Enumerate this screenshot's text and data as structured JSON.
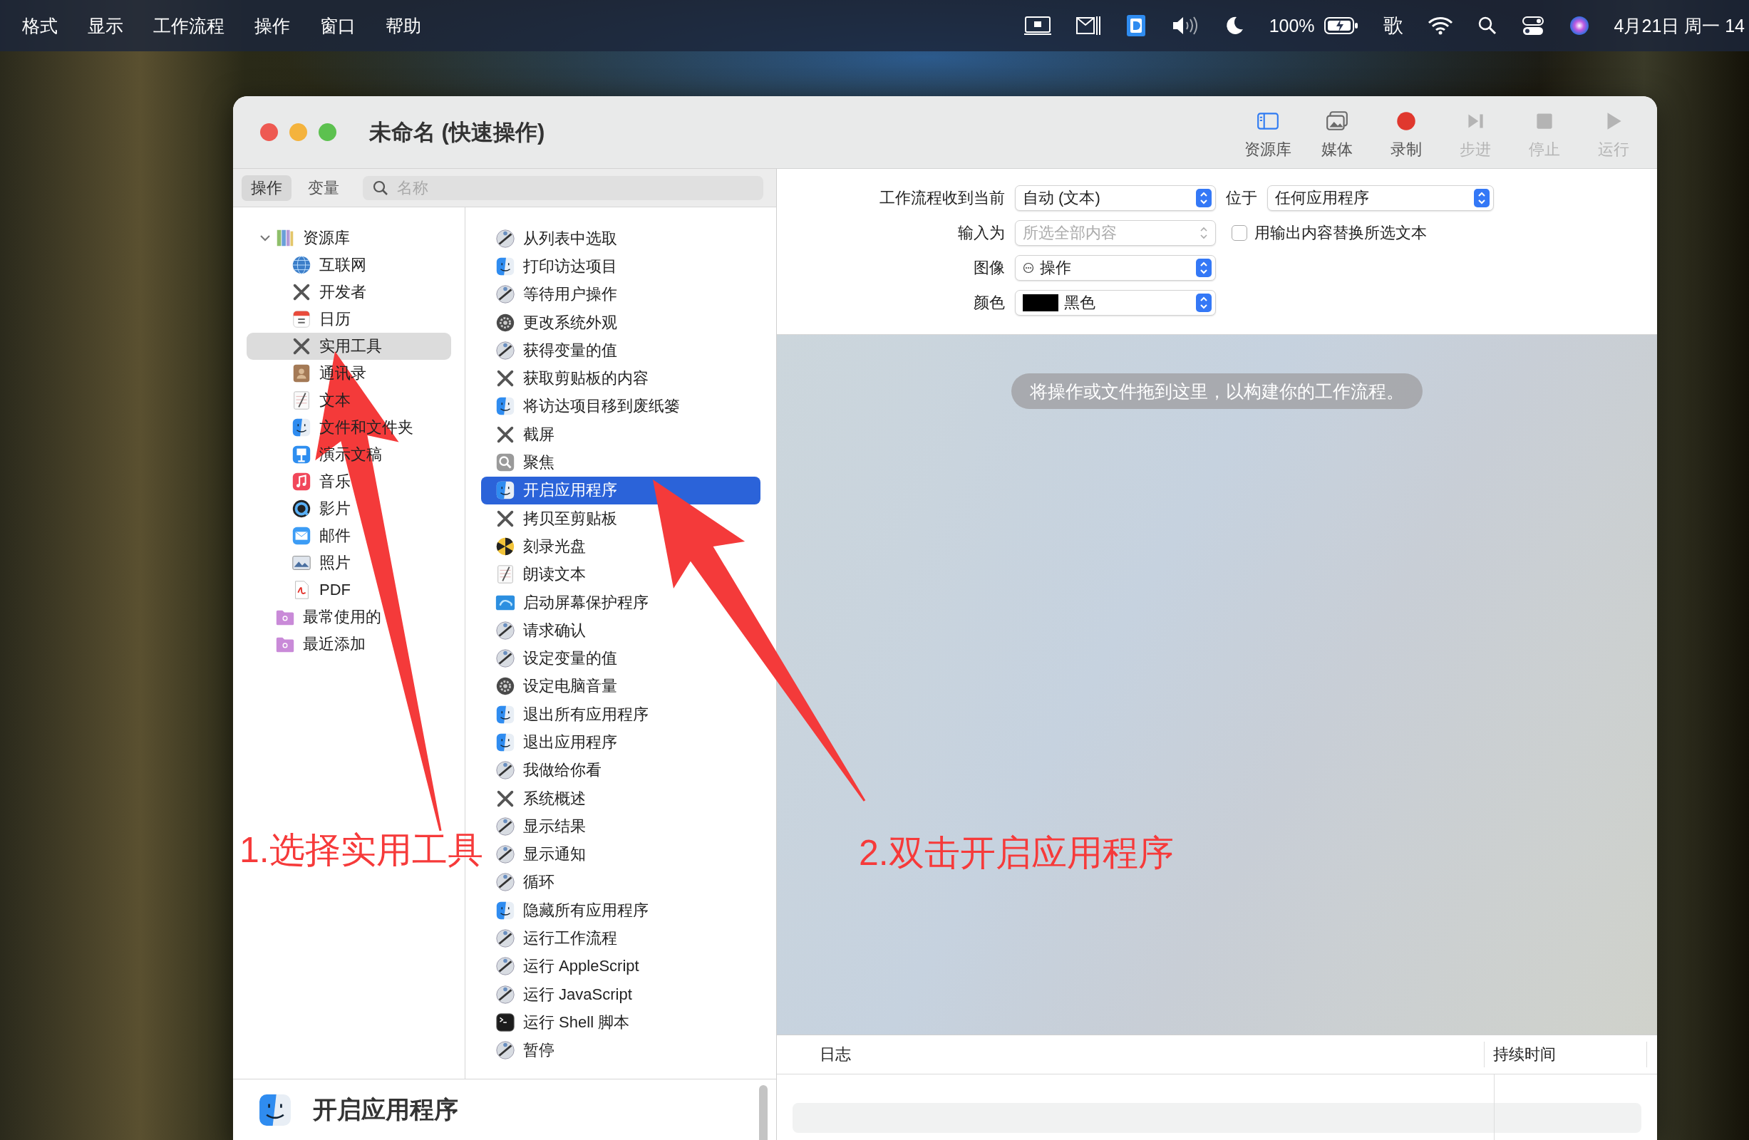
{
  "menu_bar": {
    "menus": [
      "格式",
      "显示",
      "工作流程",
      "操作",
      "窗口",
      "帮助"
    ],
    "battery": "100%",
    "input_method": "歌",
    "clock": "4月21日 周一 14"
  },
  "window": {
    "title": "未命名 (快速操作)",
    "toolbar": [
      {
        "label": "资源库",
        "kind": "library",
        "on": true,
        "disabled": false
      },
      {
        "label": "媒体",
        "kind": "media",
        "on": false,
        "disabled": false
      },
      {
        "label": "录制",
        "kind": "record",
        "disabled": false
      },
      {
        "label": "步进",
        "kind": "step",
        "disabled": true
      },
      {
        "label": "停止",
        "kind": "stop",
        "disabled": true
      },
      {
        "label": "运行",
        "kind": "run",
        "disabled": true
      }
    ]
  },
  "library_tabs": [
    {
      "label": "操作",
      "selected": true
    },
    {
      "label": "变量",
      "selected": false
    }
  ],
  "search": {
    "placeholder": "名称"
  },
  "library": [
    {
      "label": "资源库",
      "kind": "library",
      "expanded": true,
      "selected": false,
      "children": [
        {
          "label": "互联网",
          "kind": "globe",
          "selected": false
        },
        {
          "label": "开发者",
          "kind": "tools",
          "selected": false
        },
        {
          "label": "日历",
          "kind": "calendar",
          "selected": false
        },
        {
          "label": "实用工具",
          "kind": "tools",
          "selected": true
        },
        {
          "label": "通讯录",
          "kind": "contacts",
          "selected": false
        },
        {
          "label": "文本",
          "kind": "textedit",
          "selected": false
        },
        {
          "label": "文件和文件夹",
          "kind": "finder",
          "selected": false
        },
        {
          "label": "演示文稿",
          "kind": "keynote",
          "selected": false
        },
        {
          "label": "音乐",
          "kind": "music",
          "selected": false
        },
        {
          "label": "影片",
          "kind": "quicktime",
          "selected": false
        },
        {
          "label": "邮件",
          "kind": "mail",
          "selected": false
        },
        {
          "label": "照片",
          "kind": "photos",
          "selected": false
        },
        {
          "label": "PDF",
          "kind": "pdf",
          "selected": false
        }
      ]
    },
    {
      "label": "最常使用的",
      "kind": "smart-folder",
      "selected": false
    },
    {
      "label": "最近添加",
      "kind": "smart-folder",
      "selected": false
    }
  ],
  "actions": [
    {
      "label": "从列表中选取",
      "kind": "automator",
      "selected": false
    },
    {
      "label": "打印访达项目",
      "kind": "finder",
      "selected": false
    },
    {
      "label": "等待用户操作",
      "kind": "automator",
      "selected": false
    },
    {
      "label": "更改系统外观",
      "kind": "gear",
      "selected": false
    },
    {
      "label": "获得变量的值",
      "kind": "automator",
      "selected": false
    },
    {
      "label": "获取剪贴板的内容",
      "kind": "tools",
      "selected": false
    },
    {
      "label": "将访达项目移到废纸篓",
      "kind": "finder",
      "selected": false
    },
    {
      "label": "截屏",
      "kind": "tools",
      "selected": false
    },
    {
      "label": "聚焦",
      "kind": "spotlight",
      "selected": false
    },
    {
      "label": "开启应用程序",
      "kind": "finder",
      "selected": true
    },
    {
      "label": "拷贝至剪贴板",
      "kind": "tools",
      "selected": false
    },
    {
      "label": "刻录光盘",
      "kind": "disc",
      "selected": false
    },
    {
      "label": "朗读文本",
      "kind": "textedit",
      "selected": false
    },
    {
      "label": "启动屏幕保护程序",
      "kind": "screensaver",
      "selected": false
    },
    {
      "label": "请求确认",
      "kind": "automator",
      "selected": false
    },
    {
      "label": "设定变量的值",
      "kind": "automator",
      "selected": false
    },
    {
      "label": "设定电脑音量",
      "kind": "gear",
      "selected": false
    },
    {
      "label": "退出所有应用程序",
      "kind": "finder",
      "selected": false
    },
    {
      "label": "退出应用程序",
      "kind": "finder",
      "selected": false
    },
    {
      "label": "我做给你看",
      "kind": "automator",
      "selected": false
    },
    {
      "label": "系统概述",
      "kind": "tools",
      "selected": false
    },
    {
      "label": "显示结果",
      "kind": "automator",
      "selected": false
    },
    {
      "label": "显示通知",
      "kind": "automator",
      "selected": false
    },
    {
      "label": "循环",
      "kind": "automator",
      "selected": false
    },
    {
      "label": "隐藏所有应用程序",
      "kind": "finder",
      "selected": false
    },
    {
      "label": "运行工作流程",
      "kind": "automator",
      "selected": false
    },
    {
      "label": "运行 AppleScript",
      "kind": "automator",
      "selected": false
    },
    {
      "label": "运行 JavaScript",
      "kind": "automator",
      "selected": false
    },
    {
      "label": "运行 Shell 脚本",
      "kind": "terminal",
      "selected": false
    },
    {
      "label": "暂停",
      "kind": "automator",
      "selected": false
    }
  ],
  "description": {
    "title": "开启应用程序",
    "kind": "finder"
  },
  "workflow_settings": {
    "receives_label": "工作流程收到当前",
    "receives": {
      "value": "自动 (文本)",
      "disabled": false
    },
    "in_label": "位于",
    "in": {
      "value": "任何应用程序",
      "disabled": false
    },
    "input_label": "输入为",
    "input": {
      "value": "所选全部内容",
      "disabled": true
    },
    "replace": {
      "label": "用输出内容替换所选文本",
      "checked": false
    },
    "image_label": "图像",
    "image": {
      "value": "操作",
      "disabled": false
    },
    "color_label": "颜色",
    "color": {
      "value": "黑色",
      "color": "#000000",
      "disabled": false
    }
  },
  "canvas": {
    "hint": "将操作或文件拖到这里，以构建你的工作流程。"
  },
  "log": {
    "columns": [
      "日志",
      "持续时间"
    ]
  },
  "annotations": [
    {
      "text": "1.选择实用工具"
    },
    {
      "text": "2.双击开启应用程序"
    }
  ]
}
